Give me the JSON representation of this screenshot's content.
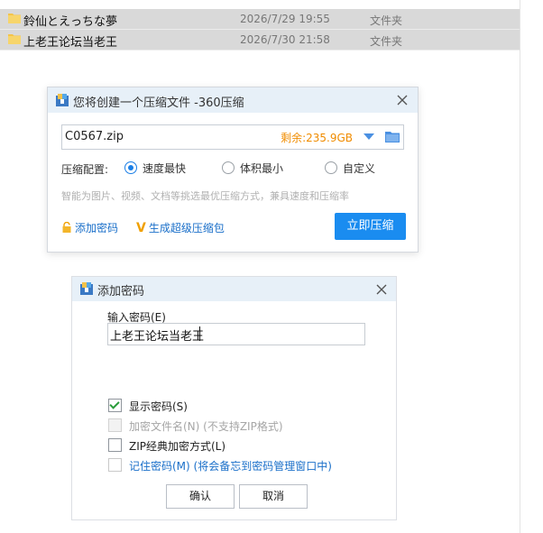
{
  "file_list": {
    "rows": [
      {
        "name": "鈴仙とえっちな夢",
        "date": "2026/7/29 19:55",
        "type": "文件夹"
      },
      {
        "name": "上老王论坛当老王",
        "date": "2026/7/30 21:58",
        "type": "文件夹"
      }
    ]
  },
  "compress_dialog": {
    "title": "您将创建一个压缩文件 -360压缩",
    "filename": "C0567.zip",
    "free_space": "剩余:235.9GB",
    "config_label": "压缩配置:",
    "options": [
      "速度最快",
      "体积最小",
      "自定义"
    ],
    "selected_option": "速度最快",
    "hint": "智能为图片、视频、文档等挑选最优压缩方式，兼具速度和压缩率",
    "add_password": "添加密码",
    "super_package": "生成超级压缩包",
    "compress_button": "立即压缩"
  },
  "password_dialog": {
    "title": "添加密码",
    "input_label": "输入密码(E)",
    "password_value": "上老王论坛当老王",
    "options": [
      {
        "label": "显示密码(S)",
        "checked": true,
        "disabled": false
      },
      {
        "label": "加密文件名(N) (不支持ZIP格式)",
        "checked": false,
        "disabled": true
      },
      {
        "label": "ZIP经典加密方式(L)",
        "checked": false,
        "disabled": false
      },
      {
        "label": "记住密码(M) (将会备忘到密码管理窗口中)",
        "checked": false,
        "disabled": false
      }
    ],
    "ok_button": "确认",
    "cancel_button": "取消"
  },
  "colors": {
    "accent": "#1a8cf0",
    "free_space": "#f08c00",
    "link": "#1a6fc9",
    "titlebar": "#e7f0f8",
    "selected_row": "#d9d9d9"
  }
}
